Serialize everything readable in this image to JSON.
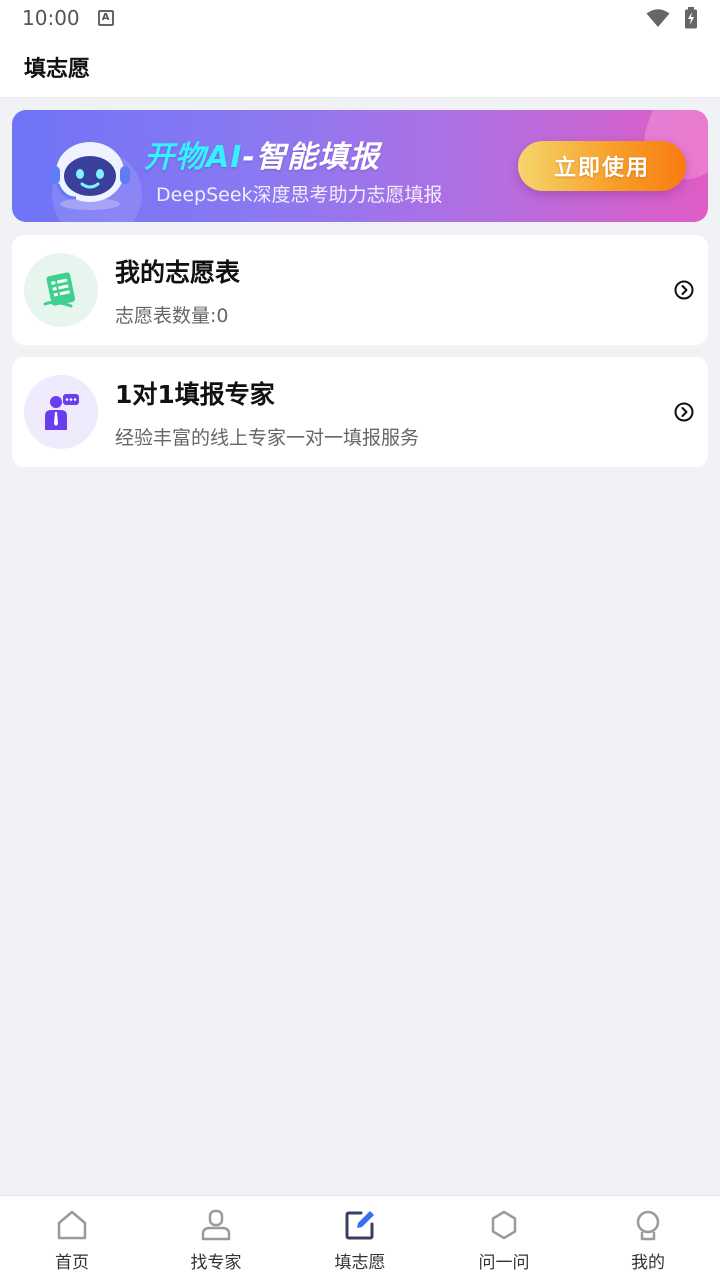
{
  "status_bar": {
    "time": "10:00",
    "notification_icon": "a-badge-icon",
    "wifi_icon": "wifi-icon",
    "battery_icon": "battery-charging-icon"
  },
  "header": {
    "title": "填志愿"
  },
  "banner": {
    "title_accent": "开物AI",
    "title_rest": "-智能填报",
    "subtitle": "DeepSeek深度思考助力志愿填报",
    "cta_label": "立即使用",
    "mascot_icon": "robot-mascot-icon"
  },
  "cards": [
    {
      "title": "我的志愿表",
      "subtitle": "志愿表数量:0",
      "icon": "checklist-document-icon",
      "icon_color": "#3fcf8e",
      "icon_bg": "#e6f6ee"
    },
    {
      "title": "1对1填报专家",
      "subtitle": "经验丰富的线上专家一对一填报服务",
      "icon": "expert-chat-icon",
      "icon_color": "#6a3df0",
      "icon_bg": "#efeafc"
    }
  ],
  "tabbar": {
    "items": [
      {
        "label": "首页",
        "icon": "home-icon"
      },
      {
        "label": "找专家",
        "icon": "person-icon"
      },
      {
        "label": "填志愿",
        "icon": "edit-form-icon",
        "active": true
      },
      {
        "label": "问一问",
        "icon": "hexagon-icon"
      },
      {
        "label": "我的",
        "icon": "profile-badge-icon"
      }
    ]
  },
  "colors": {
    "background": "#f1f2f5",
    "banner_start": "#6f73f6",
    "banner_end": "#e05cc6",
    "cta_start": "#f6d66c",
    "cta_end": "#f87b10",
    "banner_title_accent": "#36f1ff"
  }
}
